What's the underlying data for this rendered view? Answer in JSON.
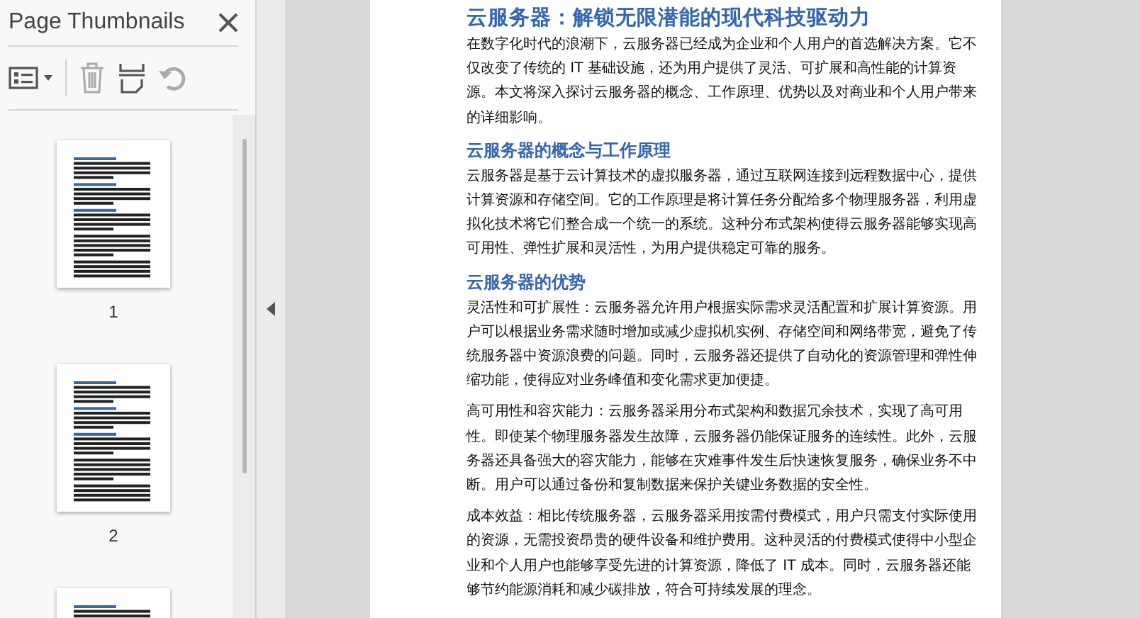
{
  "panel": {
    "title": "Page Thumbnails",
    "thumbnails": [
      {
        "label": "1"
      },
      {
        "label": "2"
      }
    ]
  },
  "document": {
    "blocks": [
      {
        "kind": "title",
        "text": "云服务器：解锁无限潜能的现代科技驱动力"
      },
      {
        "kind": "paragraph",
        "text": "在数字化时代的浪潮下，云服务器已经成为企业和个人用户的首选解决方案。它不仅改变了传统的 IT 基础设施，还为用户提供了灵活、可扩展和高性能的计算资源。本文将深入探讨云服务器的概念、工作原理、优势以及对商业和个人用户带来的详细影响。"
      },
      {
        "kind": "heading",
        "text": "云服务器的概念与工作原理"
      },
      {
        "kind": "paragraph",
        "text": "云服务器是基于云计算技术的虚拟服务器，通过互联网连接到远程数据中心，提供计算资源和存储空间。它的工作原理是将计算任务分配给多个物理服务器，利用虚拟化技术将它们整合成一个统一的系统。这种分布式架构使得云服务器能够实现高可用性、弹性扩展和灵活性，为用户提供稳定可靠的服务。"
      },
      {
        "kind": "heading",
        "text": "云服务器的优势"
      },
      {
        "kind": "paragraph",
        "text": "灵活性和可扩展性：云服务器允许用户根据实际需求灵活配置和扩展计算资源。用户可以根据业务需求随时增加或减少虚拟机实例、存储空间和网络带宽，避免了传统服务器中资源浪费的问题。同时，云服务器还提供了自动化的资源管理和弹性伸缩功能，使得应对业务峰值和变化需求更加便捷。"
      },
      {
        "kind": "paragraph",
        "text": "高可用性和容灾能力：云服务器采用分布式架构和数据冗余技术，实现了高可用性。即使某个物理服务器发生故障，云服务器仍能保证服务的连续性。此外，云服务器还具备强大的容灾能力，能够在灾难事件发生后快速恢复服务，确保业务不中断。用户可以通过备份和复制数据来保护关键业务数据的安全性。"
      },
      {
        "kind": "paragraph",
        "text": "成本效益：相比传统服务器，云服务器采用按需付费模式，用户只需支付实际使用的资源，无需投资昂贵的硬件设备和维护费用。这种灵活的付费模式使得中小型企业和个人用户也能够享受先进的计算资源，降低了 IT 成本。同时，云服务器还能够节约能源消耗和减少碳排放，符合可持续发展的理念。"
      }
    ]
  }
}
